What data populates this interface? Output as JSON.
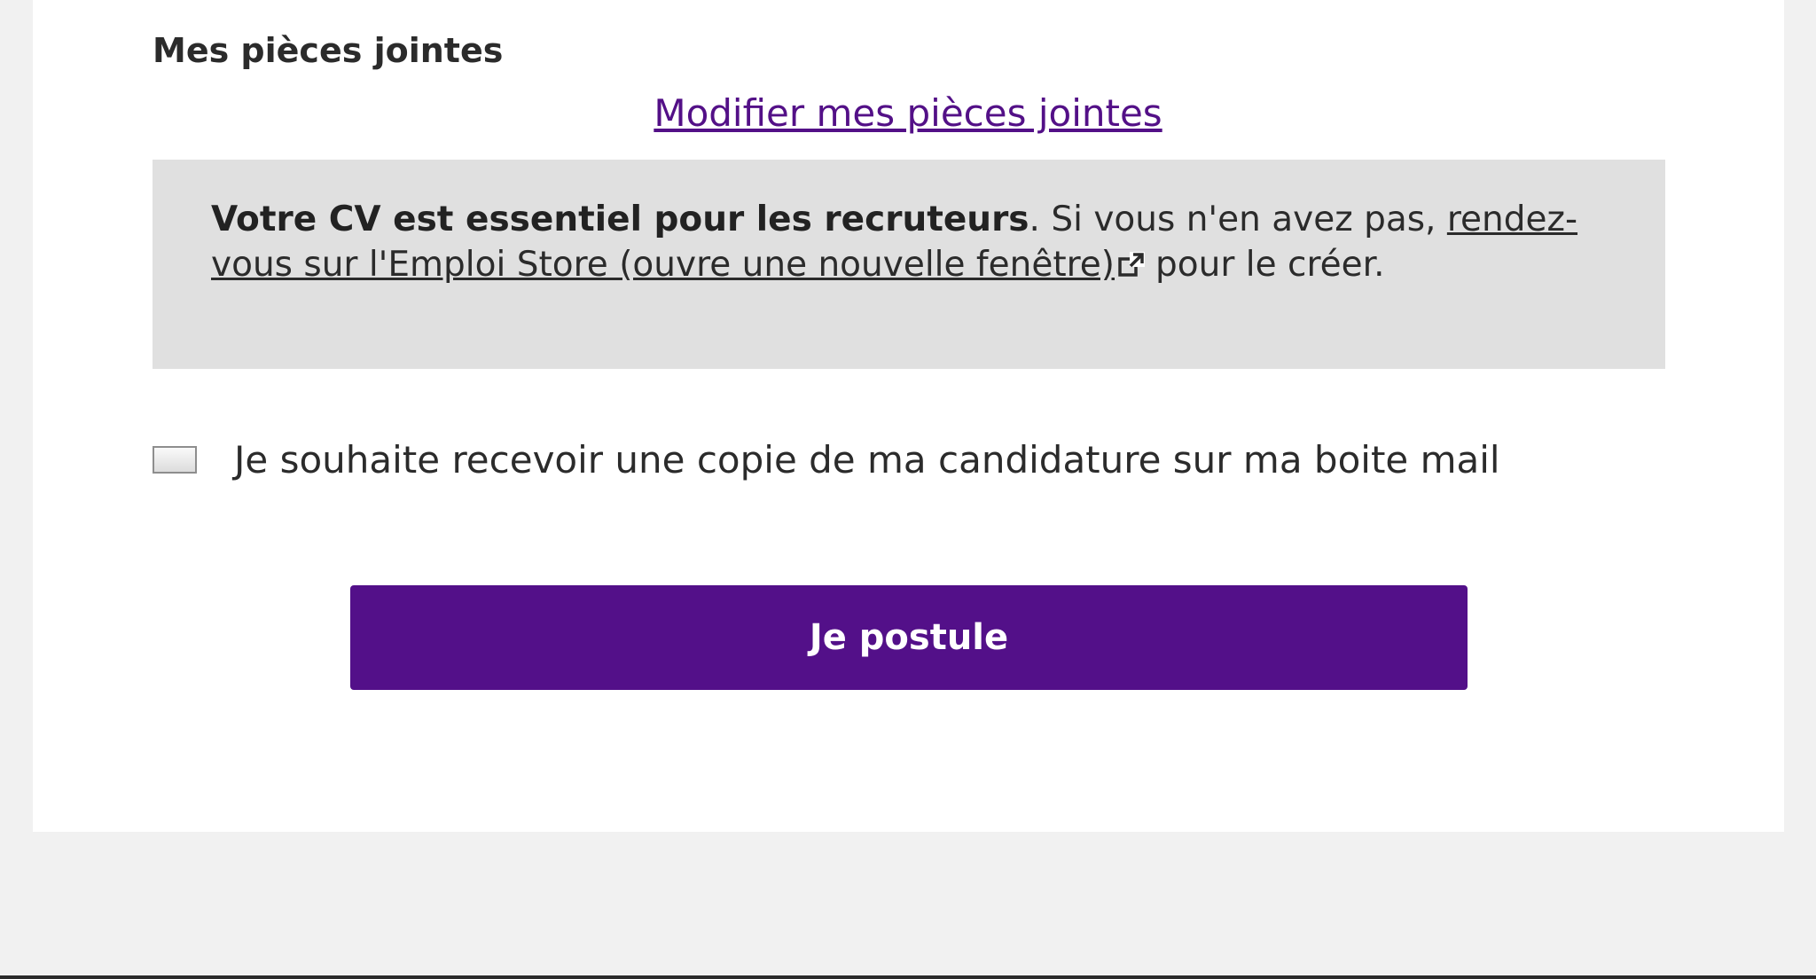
{
  "attachments": {
    "title": "Mes pièces jointes",
    "modify_link": "Modifier mes pièces jointes"
  },
  "cv_notice": {
    "strong_text": "Votre CV est essentiel pour les recruteurs",
    "text_after_strong": ". Si vous n'en avez pas, ",
    "link_text": "rendez-vous sur l'Emploi Store (ouvre une nouvelle fenêtre)",
    "text_end": "pour le créer.",
    "link_icon": "external-link-icon"
  },
  "copy_option": {
    "label": "Je souhaite recevoir une copie de ma candidature sur ma boite mail",
    "checked": false
  },
  "apply_button": {
    "label": "Je postule",
    "color": "#531089"
  },
  "colors": {
    "page_background": "#f1f1f1",
    "card_background": "#ffffff",
    "notice_background": "#e0e0e0",
    "link_color": "#531087"
  }
}
